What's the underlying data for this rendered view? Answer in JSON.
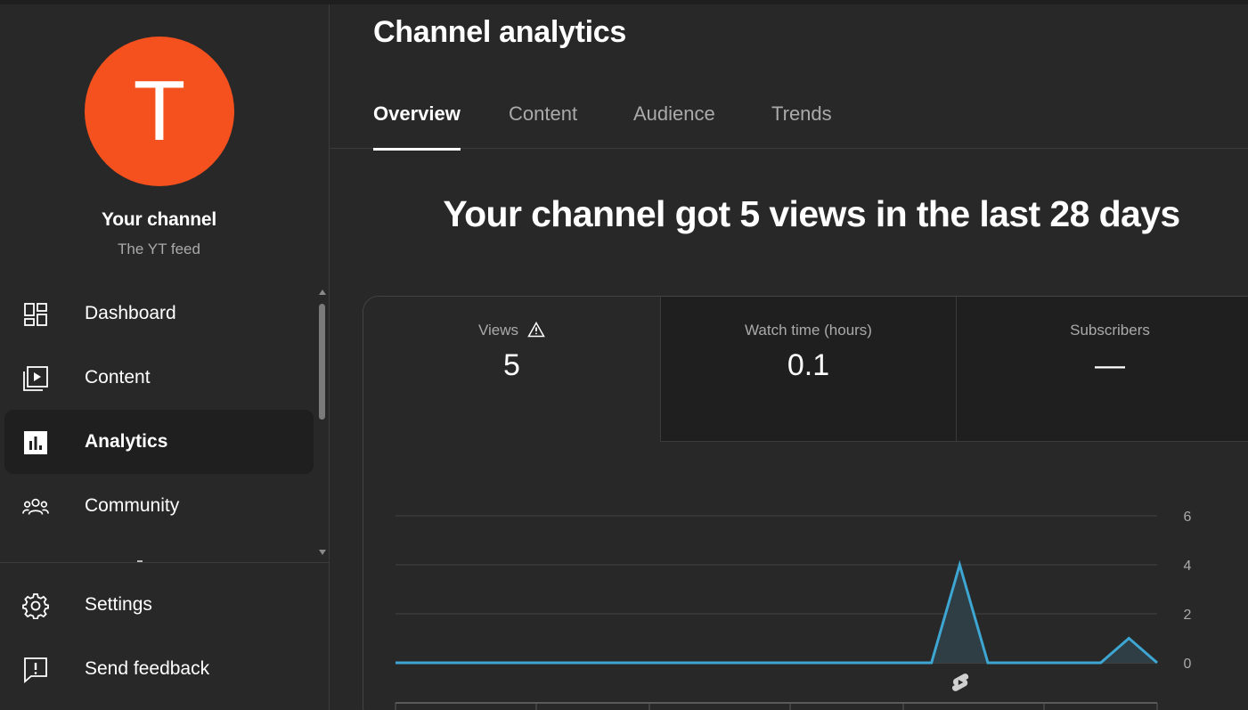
{
  "sidebar": {
    "avatar_letter": "T",
    "avatar_color": "#f4511e",
    "channel_name": "Your channel",
    "channel_handle": "The YT feed",
    "items": [
      {
        "label": "Dashboard",
        "icon": "dashboard-icon"
      },
      {
        "label": "Content",
        "icon": "content-icon"
      },
      {
        "label": "Analytics",
        "icon": "analytics-icon",
        "active": true
      },
      {
        "label": "Community",
        "icon": "community-icon"
      }
    ],
    "footer_items": [
      {
        "label": "Settings",
        "icon": "gear-icon"
      },
      {
        "label": "Send feedback",
        "icon": "feedback-icon"
      }
    ]
  },
  "main": {
    "title": "Channel analytics",
    "tabs": [
      {
        "label": "Overview",
        "active": true
      },
      {
        "label": "Content"
      },
      {
        "label": "Audience"
      },
      {
        "label": "Trends"
      }
    ],
    "headline": "Your channel got 5 views in the last 28 days",
    "metrics": [
      {
        "label": "Views",
        "value": "5",
        "icon": "warning-icon",
        "selected": true
      },
      {
        "label": "Watch time (hours)",
        "value": "0.1"
      },
      {
        "label": "Subscribers",
        "value": "—"
      }
    ]
  },
  "chart_data": {
    "type": "line",
    "y_ticks": [
      "6",
      "4",
      "2",
      "0"
    ],
    "ylim": [
      0,
      6
    ],
    "grid": true,
    "line_color": "#3ea6d2",
    "x": [
      0,
      1,
      2,
      3,
      4,
      5,
      6,
      7,
      8,
      9,
      10,
      11,
      12,
      13,
      14,
      15,
      16,
      17,
      18,
      19,
      20,
      21,
      22,
      23,
      24,
      25,
      26,
      27
    ],
    "values": [
      0,
      0,
      0,
      0,
      0,
      0,
      0,
      0,
      0,
      0,
      0,
      0,
      0,
      0,
      0,
      0,
      0,
      0,
      0,
      0,
      4,
      0,
      0,
      0,
      0,
      0,
      1,
      0
    ],
    "annotation_icon": "shorts-icon"
  }
}
